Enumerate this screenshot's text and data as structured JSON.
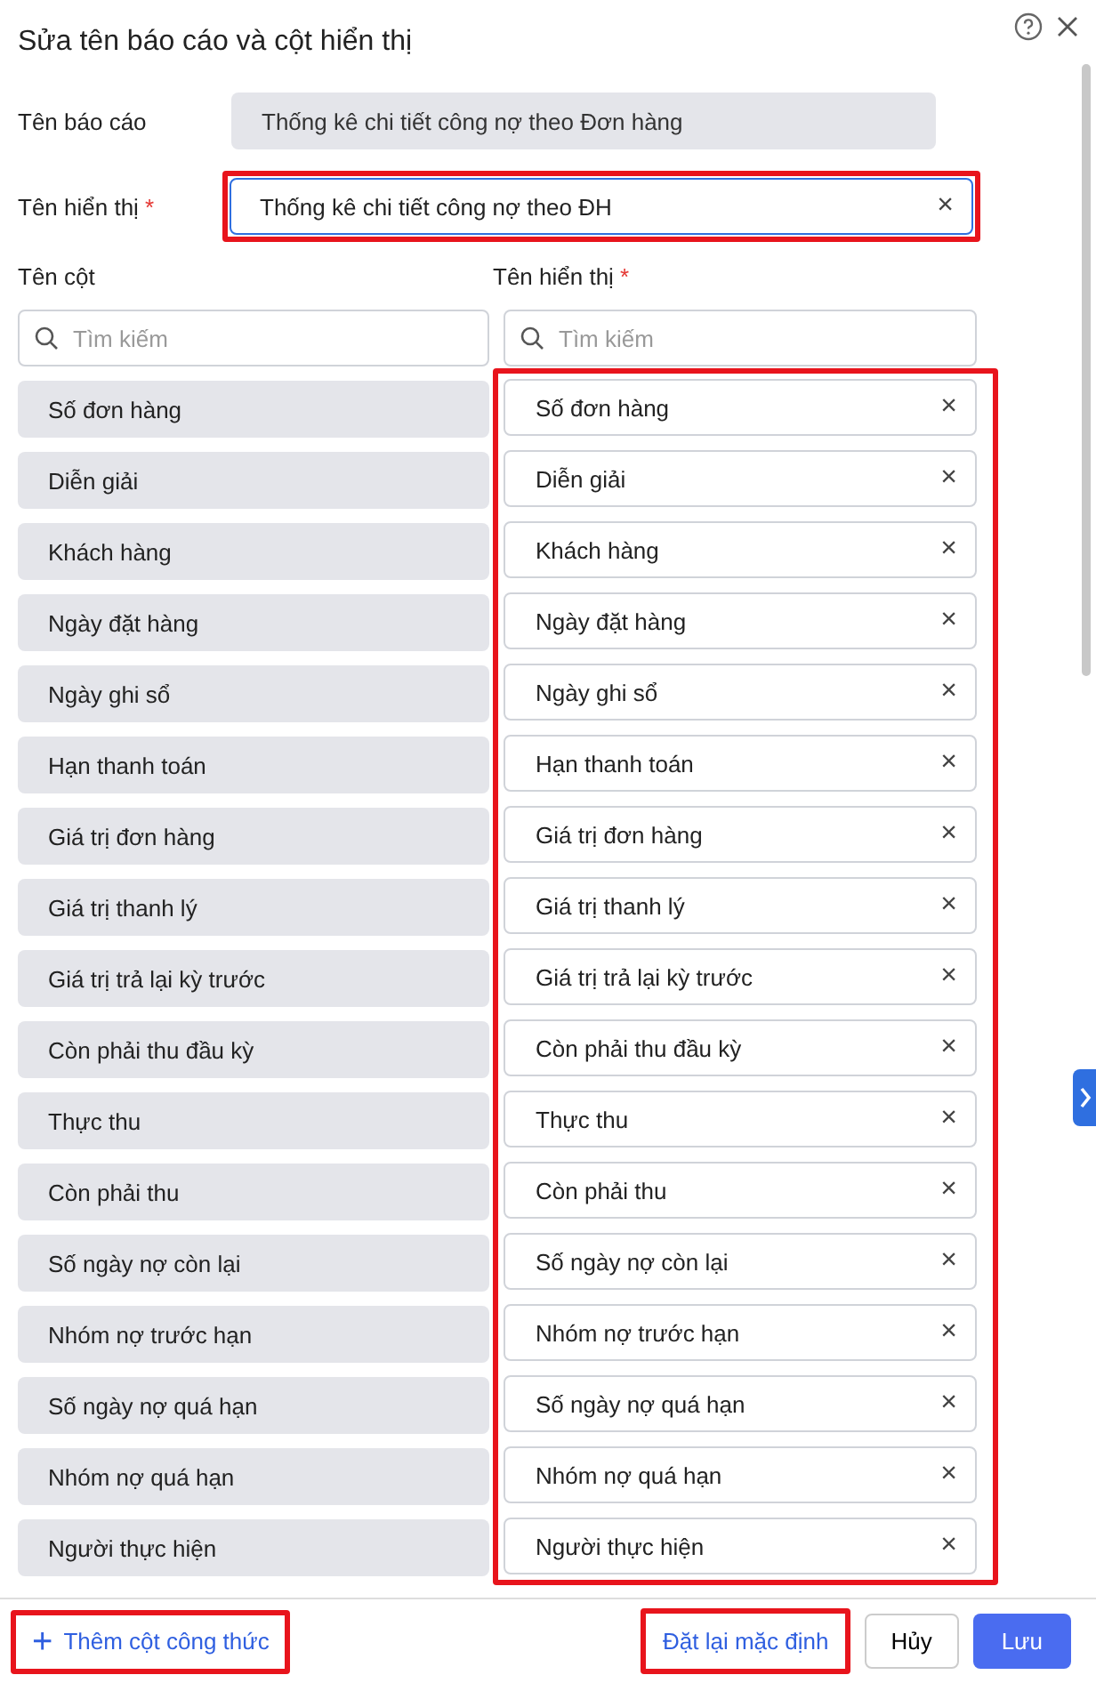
{
  "dialog": {
    "title": "Sửa tên báo cáo và cột hiển thị"
  },
  "report_name": {
    "label": "Tên báo cáo",
    "value": "Thống kê chi tiết công nợ theo Đơn hàng",
    "disabled": true
  },
  "display_name": {
    "label": "Tên hiển thị",
    "required_mark": "*",
    "value": "Thống kê chi tiết công nợ theo ĐH",
    "highlighted": true,
    "clear": "×"
  },
  "columns": {
    "source_label": "Tên cột",
    "display_label": "Tên hiển thị",
    "required_mark": "*",
    "source_search_placeholder": "Tìm kiếm",
    "display_search_placeholder": "Tìm kiếm",
    "display_highlighted": true,
    "rows": [
      {
        "source": "Số đơn hàng",
        "display": "Số đơn hàng"
      },
      {
        "source": "Diễn giải",
        "display": "Diễn giải"
      },
      {
        "source": "Khách hàng",
        "display": "Khách hàng"
      },
      {
        "source": "Ngày đặt hàng",
        "display": "Ngày đặt hàng"
      },
      {
        "source": "Ngày ghi sổ",
        "display": "Ngày ghi sổ"
      },
      {
        "source": "Hạn thanh toán",
        "display": "Hạn thanh toán"
      },
      {
        "source": "Giá trị đơn hàng",
        "display": "Giá trị đơn hàng"
      },
      {
        "source": "Giá trị thanh lý",
        "display": "Giá trị thanh lý"
      },
      {
        "source": "Giá trị trả lại kỳ trước",
        "display": "Giá trị trả lại kỳ trước"
      },
      {
        "source": "Còn phải thu đầu kỳ",
        "display": "Còn phải thu đầu kỳ"
      },
      {
        "source": "Thực thu",
        "display": "Thực thu"
      },
      {
        "source": "Còn phải thu",
        "display": "Còn phải thu"
      },
      {
        "source": "Số ngày nợ còn lại",
        "display": "Số ngày nợ còn lại"
      },
      {
        "source": "Nhóm nợ trước hạn",
        "display": "Nhóm nợ trước hạn"
      },
      {
        "source": "Số ngày nợ quá hạn",
        "display": "Số ngày nợ quá hạn"
      },
      {
        "source": "Nhóm nợ quá hạn",
        "display": "Nhóm nợ quá hạn"
      },
      {
        "source": "Người thực hiện",
        "display": "Người thực hiện"
      }
    ]
  },
  "footer": {
    "add_formula": {
      "icon": "+",
      "label": "Thêm cột công thức",
      "highlighted": true
    },
    "reset": {
      "label": "Đặt lại mặc định",
      "highlighted": true
    },
    "cancel": {
      "label": "Hủy"
    },
    "save": {
      "label": "Lưu"
    }
  }
}
